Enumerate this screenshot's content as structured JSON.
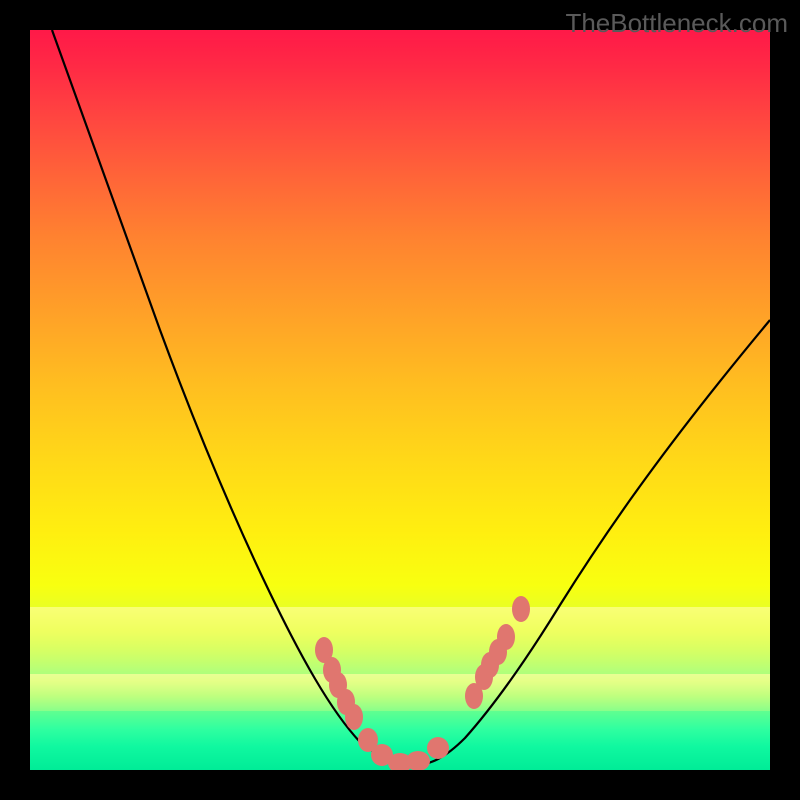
{
  "watermark": "TheBottleneck.com",
  "chart_data": {
    "type": "line",
    "title": "",
    "xlabel": "",
    "ylabel": "",
    "xlim": [
      0,
      1
    ],
    "ylim": [
      0,
      1
    ],
    "series": [
      {
        "name": "curve",
        "x": [
          0.03,
          0.08,
          0.14,
          0.2,
          0.26,
          0.32,
          0.36,
          0.4,
          0.43,
          0.46,
          0.49,
          0.52,
          0.55,
          0.58,
          0.62,
          0.68,
          0.76,
          0.84,
          0.92,
          1.0
        ],
        "y": [
          1.0,
          0.86,
          0.7,
          0.54,
          0.4,
          0.27,
          0.19,
          0.12,
          0.07,
          0.04,
          0.02,
          0.02,
          0.03,
          0.06,
          0.11,
          0.2,
          0.33,
          0.45,
          0.55,
          0.63
        ]
      }
    ],
    "markers": [
      {
        "x": 0.397,
        "y": 0.162
      },
      {
        "x": 0.408,
        "y": 0.135
      },
      {
        "x": 0.416,
        "y": 0.115
      },
      {
        "x": 0.427,
        "y": 0.092
      },
      {
        "x": 0.438,
        "y": 0.072
      },
      {
        "x": 0.457,
        "y": 0.04
      },
      {
        "x": 0.476,
        "y": 0.02
      },
      {
        "x": 0.5,
        "y": 0.01
      },
      {
        "x": 0.524,
        "y": 0.012
      },
      {
        "x": 0.551,
        "y": 0.028
      },
      {
        "x": 0.6,
        "y": 0.1
      },
      {
        "x": 0.614,
        "y": 0.125
      },
      {
        "x": 0.622,
        "y": 0.142
      },
      {
        "x": 0.632,
        "y": 0.16
      },
      {
        "x": 0.643,
        "y": 0.18
      },
      {
        "x": 0.664,
        "y": 0.218
      }
    ],
    "gradient_stops": [
      {
        "pos": 0.0,
        "color": "#ff1948"
      },
      {
        "pos": 0.5,
        "color": "#ffd818"
      },
      {
        "pos": 0.85,
        "color": "#ffff80"
      },
      {
        "pos": 1.0,
        "color": "#00ec97"
      }
    ]
  }
}
